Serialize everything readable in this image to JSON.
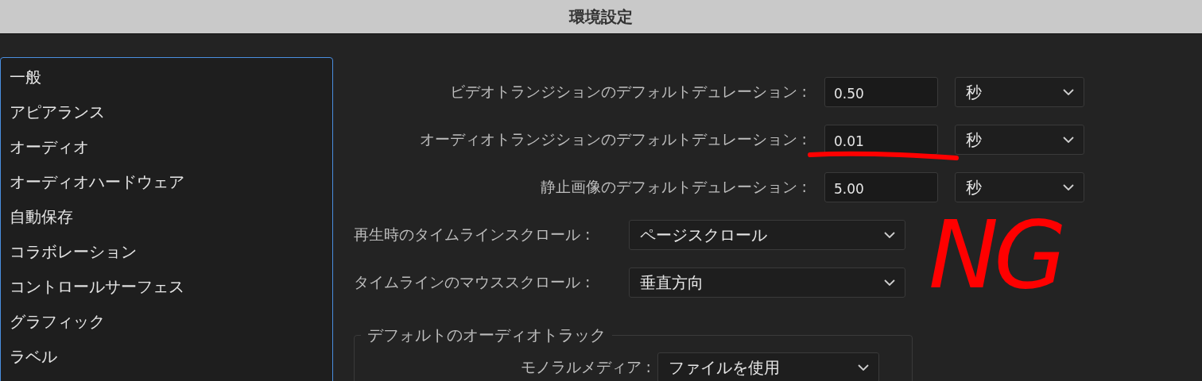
{
  "window": {
    "title": "環境設定"
  },
  "sidebar": {
    "items": [
      {
        "label": "一般"
      },
      {
        "label": "アピアランス"
      },
      {
        "label": "オーディオ"
      },
      {
        "label": "オーディオハードウェア"
      },
      {
        "label": "自動保存"
      },
      {
        "label": "コラボレーション"
      },
      {
        "label": "コントロールサーフェス"
      },
      {
        "label": "グラフィック"
      },
      {
        "label": "ラベル"
      }
    ]
  },
  "settings": [
    {
      "kind": "duration",
      "label": "ビデオトランジションのデフォルトデュレーション :",
      "value": "0.50",
      "unit": "秒"
    },
    {
      "kind": "duration",
      "label": "オーディオトランジションのデフォルトデュレーション :",
      "value": "0.01",
      "unit": "秒"
    },
    {
      "kind": "duration",
      "label": "静止画像のデフォルトデュレーション :",
      "value": "5.00",
      "unit": "秒"
    },
    {
      "kind": "choice",
      "label": "再生時のタイムラインスクロール :",
      "value": "ページスクロール"
    },
    {
      "kind": "choice",
      "label": "タイムラインのマウススクロール :",
      "value": "垂直方向"
    }
  ],
  "audio_track_group": {
    "title": "デフォルトのオーディオトラック",
    "rows": [
      {
        "label": "モノラルメディア :",
        "value": "ファイルを使用"
      }
    ]
  },
  "annotations": [
    {
      "kind": "underline"
    },
    {
      "kind": "note",
      "text": "NG"
    }
  ]
}
